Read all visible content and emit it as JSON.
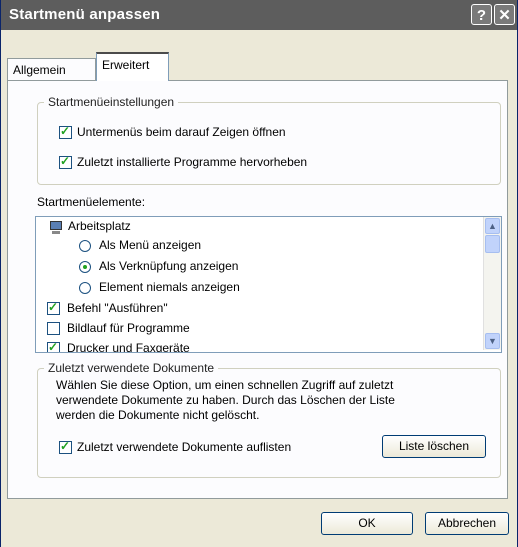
{
  "window": {
    "title": "Startmenü anpassen",
    "help_label": "?",
    "close_label": "✕"
  },
  "tabs": [
    {
      "label": "Allgemein"
    },
    {
      "label": "Erweitert"
    }
  ],
  "settings_group": {
    "legend": "Startmenüeinstellungen",
    "options": [
      {
        "label": "Untermenüs beim darauf Zeigen öffnen",
        "checked": true
      },
      {
        "label": "Zuletzt installierte Programme hervorheben",
        "checked": true
      }
    ]
  },
  "elements": {
    "label": "Startmenüelemente:",
    "items": [
      {
        "label": "Arbeitsplatz",
        "kind": "header",
        "icon": "computer-icon"
      },
      {
        "label": "Als Menü anzeigen",
        "kind": "radio",
        "checked": false
      },
      {
        "label": "Als Verknüpfung anzeigen",
        "kind": "radio",
        "checked": true
      },
      {
        "label": "Element niemals anzeigen",
        "kind": "radio",
        "checked": false
      },
      {
        "label": "Befehl \"Ausführen\"",
        "kind": "checkbox",
        "checked": true
      },
      {
        "label": "Bildlauf für Programme",
        "kind": "checkbox",
        "checked": false
      },
      {
        "label": "Drucker und Faxgeräte",
        "kind": "checkbox",
        "checked": true
      }
    ]
  },
  "recent_group": {
    "legend": "Zuletzt verwendete Dokumente",
    "description_line1": "Wählen Sie diese Option, um einen schnellen Zugriff auf zuletzt",
    "description_line2": "verwendete Dokumente zu haben. Durch das Löschen der Liste",
    "description_line3": "werden die Dokumente nicht gelöscht.",
    "checkbox_label": "Zuletzt verwendete Dokumente auflisten",
    "checked": true,
    "clear_button": "Liste löschen"
  },
  "buttons": {
    "ok": "OK",
    "cancel": "Abbrechen"
  },
  "colors": {
    "titlebar": "#5d5d5d",
    "dialog_bg": "#ece9d8",
    "check": "#21a121"
  }
}
